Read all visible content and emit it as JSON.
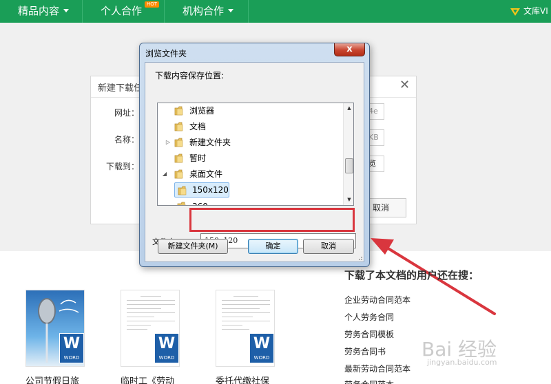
{
  "topnav": {
    "items": [
      "精品内容",
      "个人合作",
      "机构合作"
    ],
    "hot_badge": "HOT",
    "vip_label": "文库VI"
  },
  "task_dialog": {
    "title": "新建下载任",
    "close": "✕",
    "labels": [
      "网址：",
      "名称：",
      "下载到："
    ],
    "fields": [
      "4e",
      "KB",
      "览"
    ],
    "cancel": "取消"
  },
  "browse_dialog": {
    "title": "浏览文件夹",
    "close": "x",
    "description": "下载内容保存位置:",
    "tree": [
      {
        "label": "浏览器",
        "arrow": ""
      },
      {
        "label": "文档",
        "arrow": ""
      },
      {
        "label": "新建文件夹",
        "arrow": "▷"
      },
      {
        "label": "暂时",
        "arrow": ""
      },
      {
        "label": "桌面文件",
        "arrow": "◢"
      },
      {
        "label": "150x120",
        "arrow": ""
      },
      {
        "label": "360",
        "arrow": ""
      }
    ],
    "folder_label": "文件夹(F):",
    "folder_value": "150x120",
    "new_folder": "新建文件夹(M)",
    "ok": "确定",
    "cancel": "取消"
  },
  "docs": [
    {
      "caption": "公司节假日旅",
      "word": "W",
      "word_label": "WORD"
    },
    {
      "caption": "临时工《劳动",
      "word": "W",
      "word_label": "WORD"
    },
    {
      "caption": "委托代缴社保_",
      "word": "W",
      "word_label": "WORD"
    }
  ],
  "sidebar": {
    "title": "下载了本文档的用户还在搜：",
    "items": [
      "企业劳动合同范本",
      "个人劳务合同",
      "劳务合同模板",
      "劳务合同书",
      "最新劳动合同范本",
      "劳务合同范本"
    ]
  },
  "watermark": {
    "main": "Bai 经验",
    "sub": "jingyan.baidu.com"
  },
  "colors": {
    "nav_green": "#1a9e57",
    "annotation_red": "#d9363e",
    "word_blue": "#1e5fa8"
  }
}
